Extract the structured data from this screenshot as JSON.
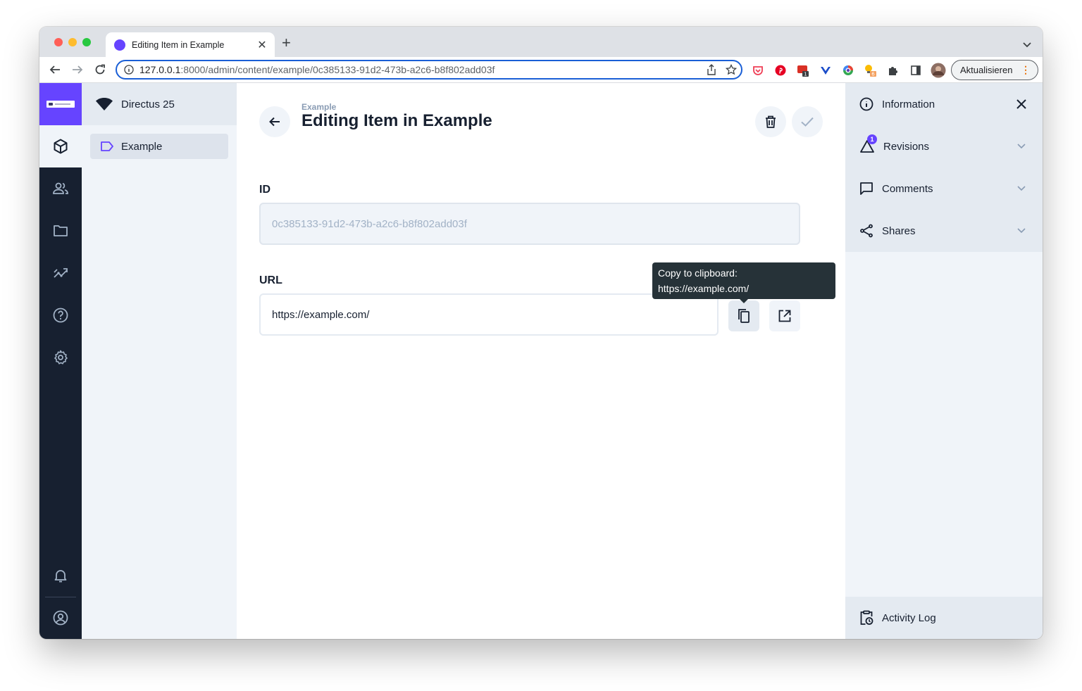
{
  "browser": {
    "tab_title": "Editing Item in Example",
    "url_host": "127.0.0.1",
    "url_rest": ":8000/admin/content/example/0c385133-91d2-473b-a2c6-b8f802add03f",
    "update_label": "Aktualisieren",
    "extensions": [
      "pocket-icon",
      "pinterest-icon",
      "extension-badge-icon",
      "vivaldi-icon",
      "color-picker-icon",
      "lightbulb-icon",
      "puzzle-icon",
      "sidepanel-icon",
      "profile-avatar"
    ],
    "ext_badges": {
      "ext1": "1",
      "ext2": "6"
    }
  },
  "project": {
    "name": "Directus 25"
  },
  "nav": {
    "items": [
      {
        "label": "Example"
      }
    ]
  },
  "header": {
    "breadcrumb": "Example",
    "title": "Editing Item in Example"
  },
  "form": {
    "id_label": "ID",
    "id_value": "0c385133-91d2-473b-a2c6-b8f802add03f",
    "url_label": "URL",
    "url_value": "https://example.com/"
  },
  "tooltip": {
    "line1": "Copy to clipboard:",
    "line2": "https://example.com/"
  },
  "sidebar": {
    "information": "Information",
    "revisions": "Revisions",
    "revisions_badge": "1",
    "comments": "Comments",
    "shares": "Shares",
    "activity_log": "Activity Log"
  },
  "colors": {
    "accent": "#6644ff",
    "dark": "#172030",
    "panel": "#f0f4f9"
  }
}
